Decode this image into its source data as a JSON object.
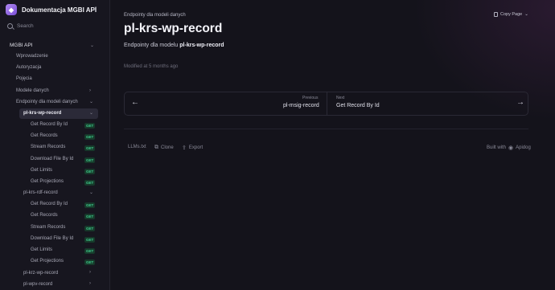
{
  "app": {
    "title": "Dokumentacja MGBI API"
  },
  "search": {
    "placeholder": "Search"
  },
  "sidebar": {
    "section": "MGBI API",
    "top_items": [
      "Wprowadzenie",
      "Autoryzacja",
      "Pojęcia",
      "Modele danych",
      "Endpointy dla modeli danych"
    ],
    "group1": {
      "label": "pl-krs-wp-record",
      "items": [
        {
          "label": "Get Record By Id",
          "method": "GET"
        },
        {
          "label": "Get Records",
          "method": "GET"
        },
        {
          "label": "Stream Records",
          "method": "GET"
        },
        {
          "label": "Download File By Id",
          "method": "GET"
        },
        {
          "label": "Get Limits",
          "method": "GET"
        },
        {
          "label": "Get Projections",
          "method": "GET"
        }
      ]
    },
    "group2": {
      "label": "pl-krs-rdf-record",
      "items": [
        {
          "label": "Get Record By Id",
          "method": "GET"
        },
        {
          "label": "Get Records",
          "method": "GET"
        },
        {
          "label": "Stream Records",
          "method": "GET"
        },
        {
          "label": "Download File By Id",
          "method": "GET"
        },
        {
          "label": "Get Limits",
          "method": "GET"
        },
        {
          "label": "Get Projections",
          "method": "GET"
        }
      ]
    },
    "bottom_items": [
      "pl-krz-wp-record",
      "pl-wpv-record"
    ]
  },
  "main": {
    "breadcrumb": "Endpointy dla modeli danych",
    "copy_label": "Copy Page",
    "title": "pl-krs-wp-record",
    "desc_prefix": "Endpointy dla modelu ",
    "desc_bold": "pl-krs-wp-record",
    "modified": "Modified at 5 months ago",
    "prev_label": "Previous",
    "prev_title": "pl-msig-record",
    "next_label": "Next",
    "next_title": "Get Record By Id"
  },
  "footer": {
    "llms": "LLMs.txt",
    "clone": "Clone",
    "export": "Export",
    "built_with": "Built with",
    "brand": "Apidog"
  }
}
